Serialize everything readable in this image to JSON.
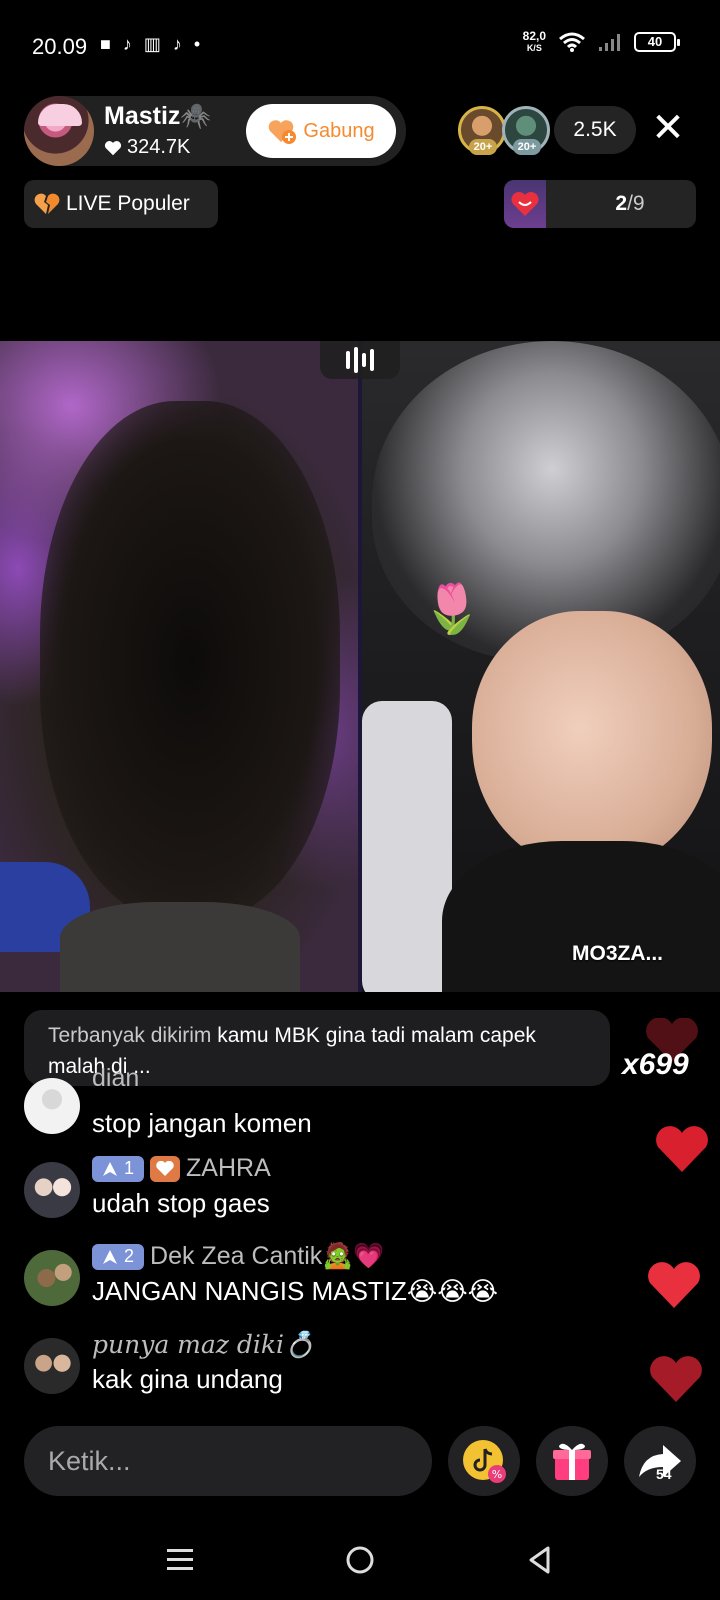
{
  "status_bar": {
    "time": "20.09",
    "net_speed": "82,0",
    "net_unit": "K/S",
    "battery": "40"
  },
  "host": {
    "name": "Mastiz🕷️",
    "likes": "324.7K",
    "join_label": "Gabung"
  },
  "viewers": {
    "badge_1": "20+",
    "badge_2": "20+",
    "count": "2.5K"
  },
  "popular": {
    "label": "LIVE Populer"
  },
  "ranking": {
    "current": "2",
    "total": "/9"
  },
  "video": {
    "guest_name": "MO3ZA..."
  },
  "top_banner": {
    "label": "Terbanyak dikirim",
    "message": "kamu MBK gina tadi malam capek malah di ...",
    "combo": "x699"
  },
  "comments": [
    {
      "name": "dian",
      "text": "stop jangan komen"
    },
    {
      "level": "1",
      "name": "ZAHRA",
      "text": "udah stop gaes"
    },
    {
      "level": "2",
      "name": "Dek Zea Cantik🧟💗",
      "text": "JANGAN NANGIS MASTIZ😭😭😭"
    },
    {
      "name": "punya maz diki💍",
      "text": "kak gina undang"
    }
  ],
  "input": {
    "placeholder": "Ketik..."
  },
  "share": {
    "count": "54"
  },
  "colors": {
    "heart_red": "#e8303e",
    "join_orange": "#f58a2e",
    "level_badge": "#7c93d8"
  }
}
